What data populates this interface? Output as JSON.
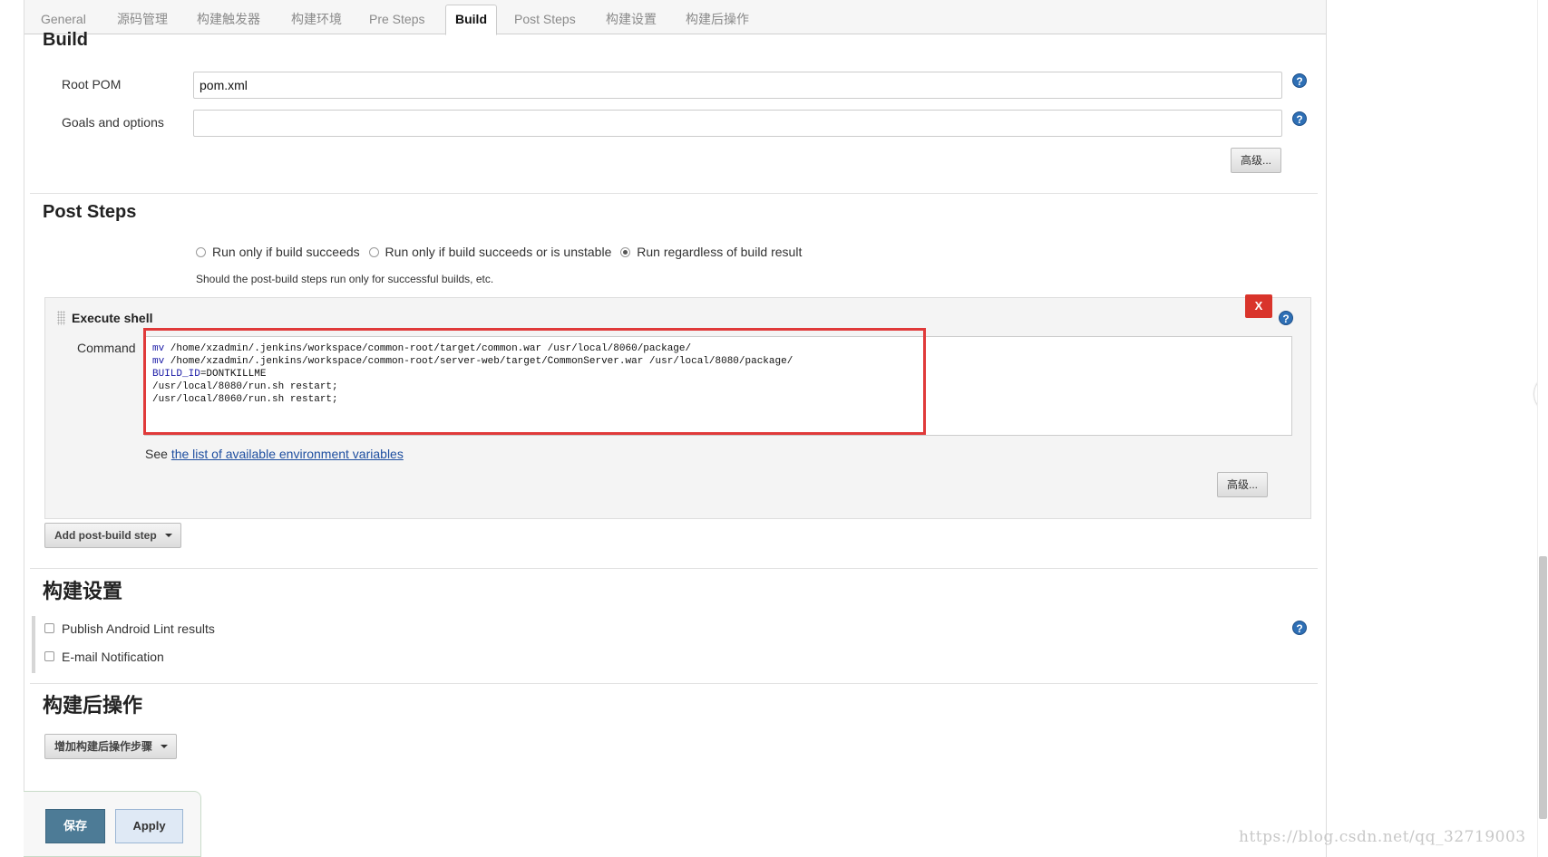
{
  "tabs": [
    {
      "label": "General"
    },
    {
      "label": "源码管理"
    },
    {
      "label": "构建触发器"
    },
    {
      "label": "构建环境"
    },
    {
      "label": "Pre Steps"
    },
    {
      "label": "Build"
    },
    {
      "label": "Post Steps"
    },
    {
      "label": "构建设置"
    },
    {
      "label": "构建后操作"
    }
  ],
  "build": {
    "title": "Build",
    "root_pom_label": "Root POM",
    "root_pom_value": "pom.xml",
    "goals_label": "Goals and options",
    "goals_value": "",
    "advanced_label": "高级..."
  },
  "post_steps": {
    "title": "Post Steps",
    "radios": [
      {
        "label": "Run only if build succeeds",
        "selected": false
      },
      {
        "label": "Run only if build succeeds or is unstable",
        "selected": false
      },
      {
        "label": "Run regardless of build result",
        "selected": true
      }
    ],
    "hint": "Should the post-build steps run only for successful builds, etc.",
    "step": {
      "title": "Execute shell",
      "delete_label": "X",
      "command_label": "Command",
      "command_lines": [
        {
          "kw": "mv",
          "rest": " /home/xzadmin/.jenkins/workspace/common-root/target/common.war /usr/local/8060/package/"
        },
        {
          "kw": "mv",
          "rest": " /home/xzadmin/.jenkins/workspace/common-root/server-web/target/CommonServer.war /usr/local/8080/package/"
        },
        {
          "kw": "BUILD_ID",
          "rest": "=DONTKILLME"
        },
        {
          "kw": "",
          "rest": "/usr/local/8080/run.sh restart;"
        },
        {
          "kw": "",
          "rest": "/usr/local/8060/run.sh restart;"
        }
      ],
      "env_prefix": "See ",
      "env_link": "the list of available environment variables",
      "advanced_label": "高级..."
    },
    "add_step_label": "Add post-build step"
  },
  "build_settings": {
    "title": "构建设置",
    "options": [
      {
        "label": "Publish Android Lint results",
        "checked": false
      },
      {
        "label": "E-mail Notification",
        "checked": false
      }
    ]
  },
  "post_build": {
    "title": "构建后操作",
    "add_label": "增加构建后操作步骤"
  },
  "footer": {
    "save_label": "保存",
    "apply_label": "Apply"
  },
  "help_icon_glyph": "?",
  "watermark": "https://blog.csdn.net/qq_32719003",
  "colors": {
    "highlight_box": "#e03a3a",
    "delete_button": "#d9342b",
    "save_button": "#4d7b96",
    "help_icon": "#2e6fb5",
    "link": "#1f4fa0"
  }
}
